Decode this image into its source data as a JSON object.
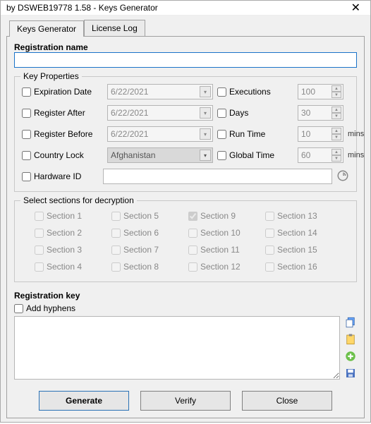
{
  "window": {
    "title": "by DSWEB19778 1.58 - Keys Generator"
  },
  "tabs": {
    "keys": "Keys Generator",
    "license": "License Log"
  },
  "registration": {
    "label": "Registration name",
    "value": ""
  },
  "keyprops": {
    "group_label": "Key Properties",
    "expiration": {
      "label": "Expiration Date",
      "date": "6/22/2021"
    },
    "register_after": {
      "label": "Register After",
      "date": "6/22/2021"
    },
    "register_before": {
      "label": "Register Before",
      "date": "6/22/2021"
    },
    "country_lock": {
      "label": "Country Lock",
      "value": "Afghanistan"
    },
    "hardware_id": {
      "label": "Hardware ID",
      "value": ""
    },
    "executions": {
      "label": "Executions",
      "value": "100"
    },
    "days": {
      "label": "Days",
      "value": "30"
    },
    "run_time": {
      "label": "Run Time",
      "value": "10",
      "unit": "mins"
    },
    "global_time": {
      "label": "Global Time",
      "value": "60",
      "unit": "mins"
    }
  },
  "sections": {
    "group_label": "Select sections for decryption",
    "items": [
      "Section 1",
      "Section 2",
      "Section 3",
      "Section 4",
      "Section 5",
      "Section 6",
      "Section 7",
      "Section 8",
      "Section 9",
      "Section 10",
      "Section 11",
      "Section 12",
      "Section 13",
      "Section 14",
      "Section 15",
      "Section 16"
    ],
    "checked_index": 8
  },
  "regkey": {
    "label": "Registration key",
    "add_hyphens": "Add hyphens",
    "value": ""
  },
  "buttons": {
    "generate": "Generate",
    "verify": "Verify",
    "close": "Close"
  }
}
